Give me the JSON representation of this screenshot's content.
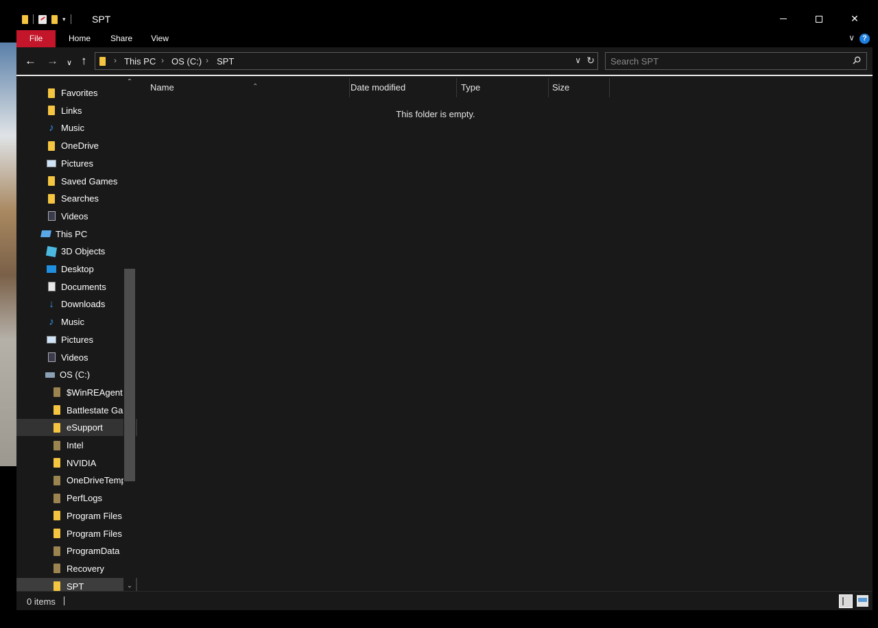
{
  "window": {
    "title": "SPT"
  },
  "ribbon": {
    "tabs": [
      "File",
      "Home",
      "Share",
      "View"
    ]
  },
  "address": {
    "crumbs": [
      "This PC",
      "OS (C:)",
      "SPT"
    ]
  },
  "search": {
    "placeholder": "Search SPT"
  },
  "nav_pane": {
    "items": [
      {
        "label": "Favorites",
        "icon": "folder-icon"
      },
      {
        "label": "Links",
        "icon": "folder-icon"
      },
      {
        "label": "Music",
        "icon": "music-icon"
      },
      {
        "label": "OneDrive",
        "icon": "folder-icon"
      },
      {
        "label": "Pictures",
        "icon": "pictures-icon"
      },
      {
        "label": "Saved Games",
        "icon": "folder-icon"
      },
      {
        "label": "Searches",
        "icon": "folder-icon"
      },
      {
        "label": "Videos",
        "icon": "videos-icon"
      },
      {
        "label": "This PC",
        "icon": "this-pc-icon"
      },
      {
        "label": "3D Objects",
        "icon": "3d-objects-icon"
      },
      {
        "label": "Desktop",
        "icon": "desktop-icon"
      },
      {
        "label": "Documents",
        "icon": "documents-icon"
      },
      {
        "label": "Downloads",
        "icon": "downloads-icon"
      },
      {
        "label": "Music",
        "icon": "music-icon"
      },
      {
        "label": "Pictures",
        "icon": "pictures-icon"
      },
      {
        "label": "Videos",
        "icon": "videos-icon"
      },
      {
        "label": "OS (C:)",
        "icon": "drive-icon"
      },
      {
        "label": "$WinREAgent",
        "icon": "folder-icon"
      },
      {
        "label": "Battlestate Ga",
        "icon": "folder-icon"
      },
      {
        "label": "eSupport",
        "icon": "folder-icon"
      },
      {
        "label": "Intel",
        "icon": "folder-icon"
      },
      {
        "label": "NVIDIA",
        "icon": "folder-icon"
      },
      {
        "label": "OneDriveTemp",
        "icon": "folder-icon"
      },
      {
        "label": "PerfLogs",
        "icon": "folder-icon"
      },
      {
        "label": "Program Files",
        "icon": "folder-icon"
      },
      {
        "label": "Program Files",
        "icon": "folder-icon"
      },
      {
        "label": "ProgramData",
        "icon": "folder-icon"
      },
      {
        "label": "Recovery",
        "icon": "folder-icon"
      },
      {
        "label": "SPT",
        "icon": "folder-icon"
      }
    ]
  },
  "file_list": {
    "columns": [
      "Name",
      "Date modified",
      "Type",
      "Size"
    ],
    "empty_message": "This folder is empty."
  },
  "status": {
    "item_count": "0 items"
  },
  "colors": {
    "file_tab": "#c4162a",
    "accent": "#1e7fe0",
    "folder": "#f5c542"
  }
}
